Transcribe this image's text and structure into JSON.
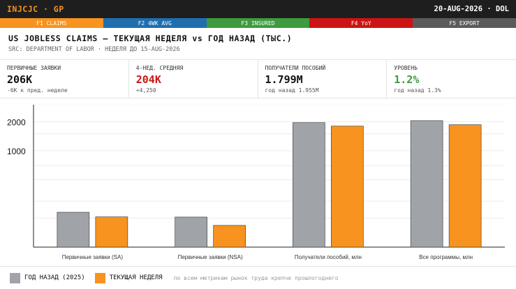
{
  "topbar": {
    "ticker": "INJCJC · GP",
    "date": "20-AUG-2026 · DOL"
  },
  "fkeys": [
    {
      "label": "F1 CLAIMS",
      "color": "#f7931e"
    },
    {
      "label": "F2 4WK AVG",
      "color": "#1f6fae"
    },
    {
      "label": "F3 INSURED",
      "color": "#3e9b3e"
    },
    {
      "label": "F4 YoY",
      "color": "#cc1414"
    },
    {
      "label": "F5 EXPORT",
      "color": "#5b5b5b"
    }
  ],
  "header": {
    "title": "US JOBLESS CLAIMS — ТЕКУЩАЯ НЕДЕЛЯ vs ГОД НАЗАД (ТЫС.)",
    "source": "SRC: DEPARTMENT OF LABOR · НЕДЕЛЯ ДО 15-AUG-2026"
  },
  "kpis": [
    {
      "label": "ПЕРВИЧНЫЕ ЗАЯВКИ",
      "value": "206K",
      "sub": "-6K к пред. неделе",
      "color": "#111111"
    },
    {
      "label": "4-НЕД. СРЕДНЯЯ",
      "value": "204K",
      "sub": "+4,250",
      "color": "#cc1414"
    },
    {
      "label": "ПОЛУЧАТЕЛИ ПОСОБИЙ",
      "value": "1.799M",
      "sub": "год назад 1.955M",
      "color": "#111111"
    },
    {
      "label": "УРОВЕНЬ",
      "value": "1.2%",
      "sub": "год назад 1.3%",
      "color": "#3e9b3e"
    }
  ],
  "legend": {
    "prev_label": "ГОД НАЗАД (2025)",
    "curr_label": "ТЕКУЩАЯ НЕДЕЛЯ",
    "note": "по всем метрикам рынок труда крепче прошлогоднего"
  },
  "chart_data": {
    "type": "bar",
    "scale": "log",
    "categories": [
      "Первичные заявки (SA)",
      "Первичные заявки (NSA)",
      "Получатели пособий, млн",
      "Все программы, млн"
    ],
    "series": [
      {
        "name": "ГОД НАЗАД (2025)",
        "color": "#a0a3a8",
        "values": [
          230,
          205,
          1955,
          2050
        ]
      },
      {
        "name": "ТЕКУЩАЯ НЕДЕЛЯ",
        "color": "#f7931e",
        "values": [
          206,
          168,
          1799,
          1860
        ]
      }
    ],
    "ytick_labels": [
      "1000",
      "2000"
    ],
    "ytick_values": [
      1000,
      2000
    ],
    "ylim": [
      100,
      3000
    ],
    "grid": true
  }
}
